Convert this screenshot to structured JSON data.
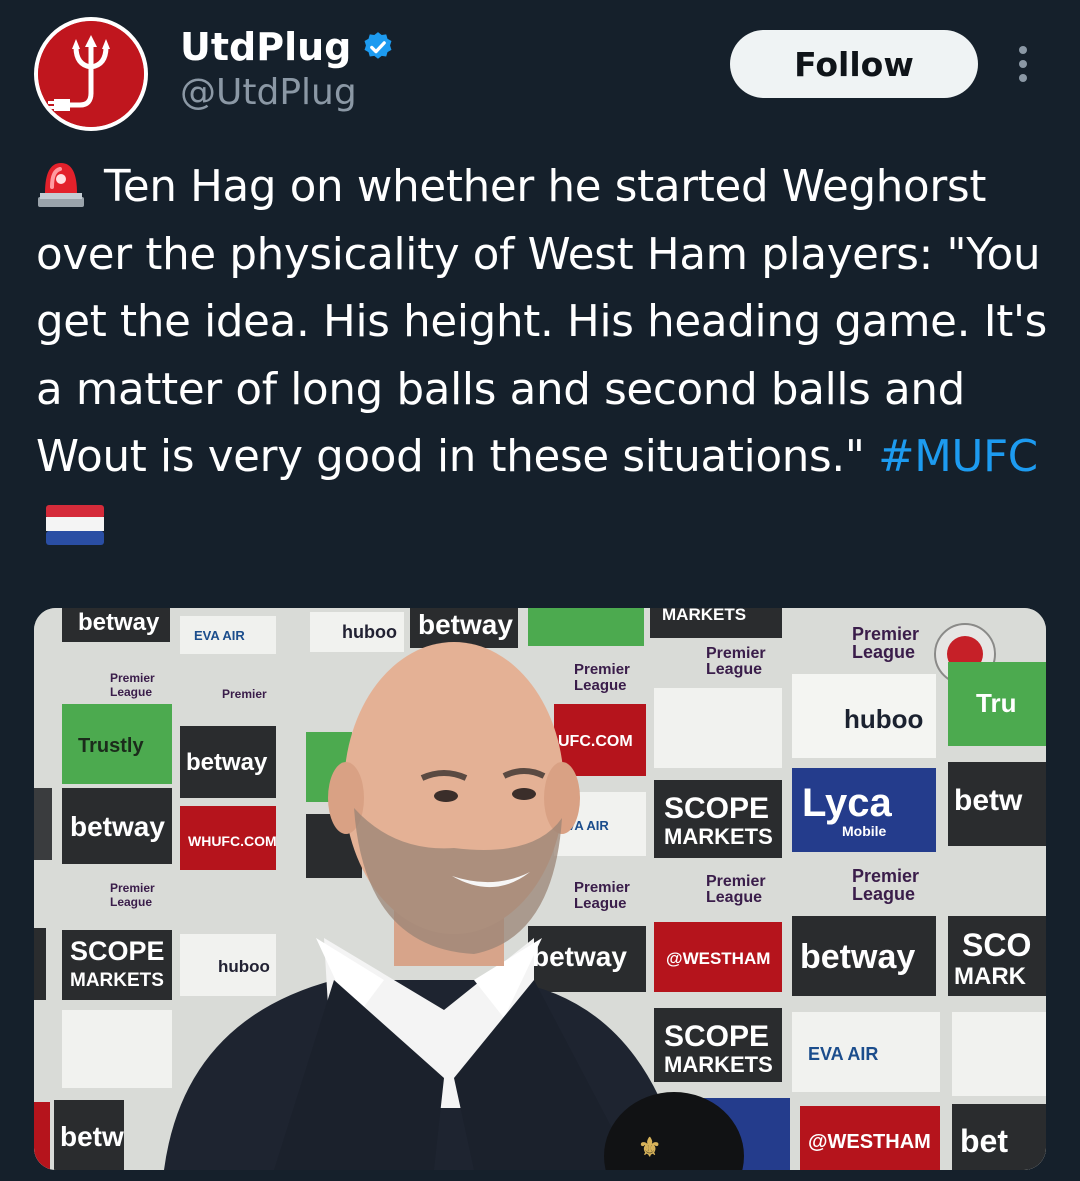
{
  "account": {
    "display_name": "UtdPlug",
    "handle": "@UtdPlug",
    "verified": true,
    "avatar_icon": "trident-plug-logo-icon"
  },
  "actions": {
    "follow_label": "Follow",
    "more_icon": "more-vertical-icon"
  },
  "tweet": {
    "lead_emoji": "police-siren-icon",
    "text": "Ten Hag on whether he started Weghorst over the physicality of West Ham players: \"You get the idea. His height. His heading game. It's a matter of long balls and second balls and Wout is very good in these situations.\" ",
    "hashtag": "#MUFC",
    "trailing_emoji": "netherlands-flag-icon"
  },
  "media": {
    "boards": {
      "betway": "betway",
      "premier": "Premier",
      "league": "League",
      "huboo": "huboo",
      "trustly": "Trustly",
      "scope": "SCOPE",
      "markets": "MARKETS",
      "lyca": "Lyca",
      "mobile": "Mobile",
      "evaair": "EVA AIR",
      "westham": "@WESTHAM",
      "whufc": "WHUFC.COM",
      "ufc": "UFC.COM",
      "markets_partial": "MARKETS"
    }
  },
  "colors": {
    "background": "#15202b",
    "handle_gray": "#8b98a5",
    "link_blue": "#1d9bf0",
    "follow_bg": "#eff3f4",
    "brand_red": "#c0161e"
  }
}
